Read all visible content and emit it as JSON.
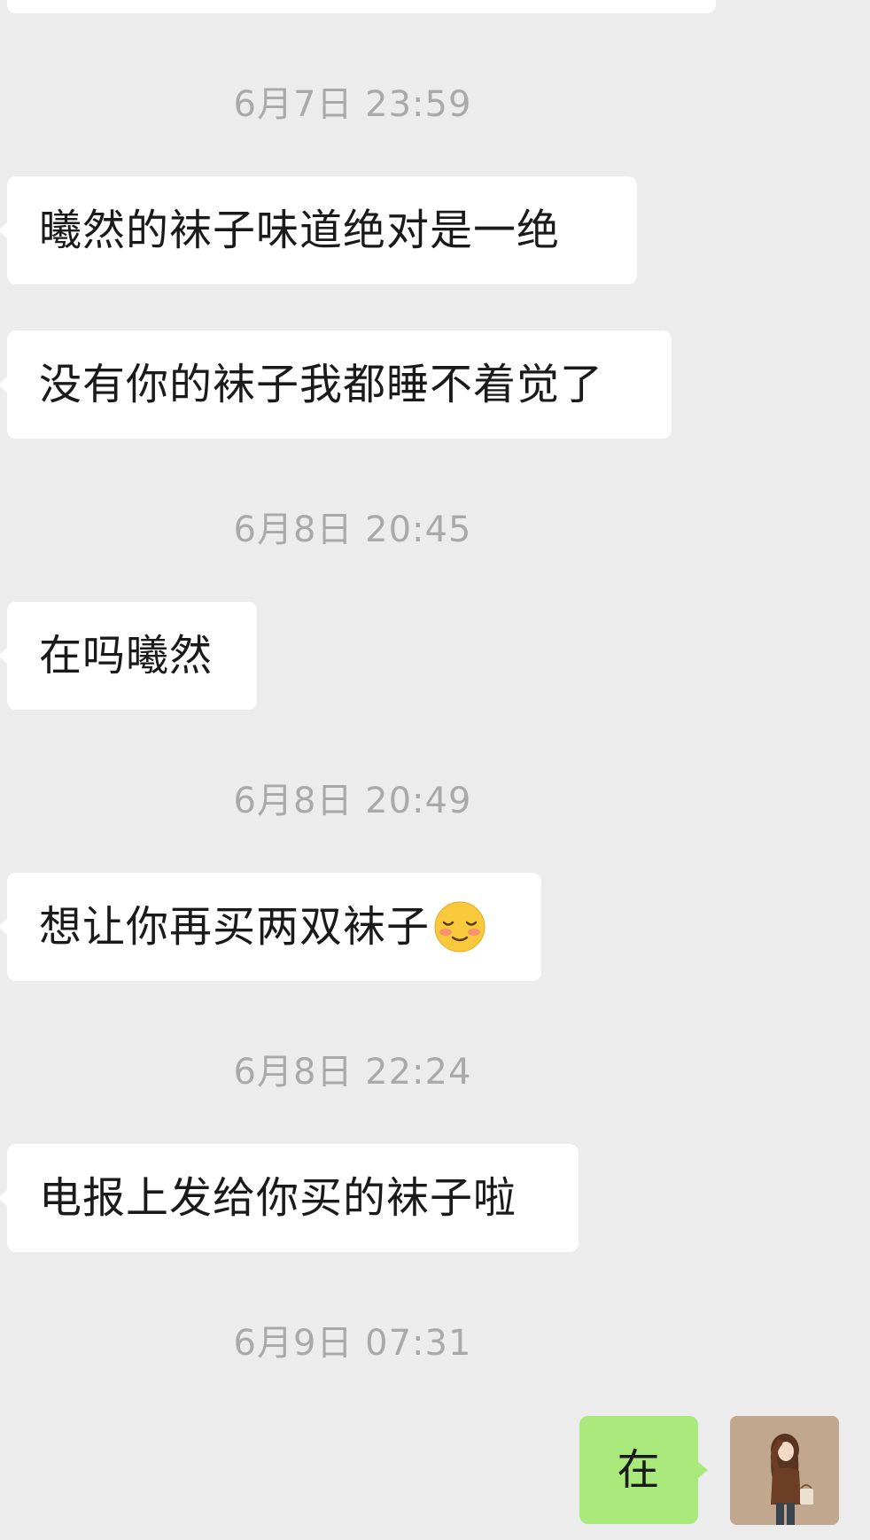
{
  "chat": {
    "timestamps": {
      "t1": "6月7日 23:59",
      "t2": "6月8日 20:45",
      "t3": "6月8日 20:49",
      "t4": "6月8日 22:24",
      "t5": "6月9日 07:31"
    },
    "messages": {
      "m1": "曦然的袜子味道绝对是一绝",
      "m2": "没有你的袜子我都睡不着觉了",
      "m3": "在吗曦然",
      "m4": "想让你再买两双袜子",
      "m4_emoji": "blushing-smile-emoji",
      "m5": "电报上发给你买的袜子啦",
      "m6": "在"
    },
    "colors": {
      "background": "#ececec",
      "incoming_bubble": "#ffffff",
      "outgoing_bubble": "#a9e97c",
      "timestamp_text": "#a9a9a9"
    }
  }
}
